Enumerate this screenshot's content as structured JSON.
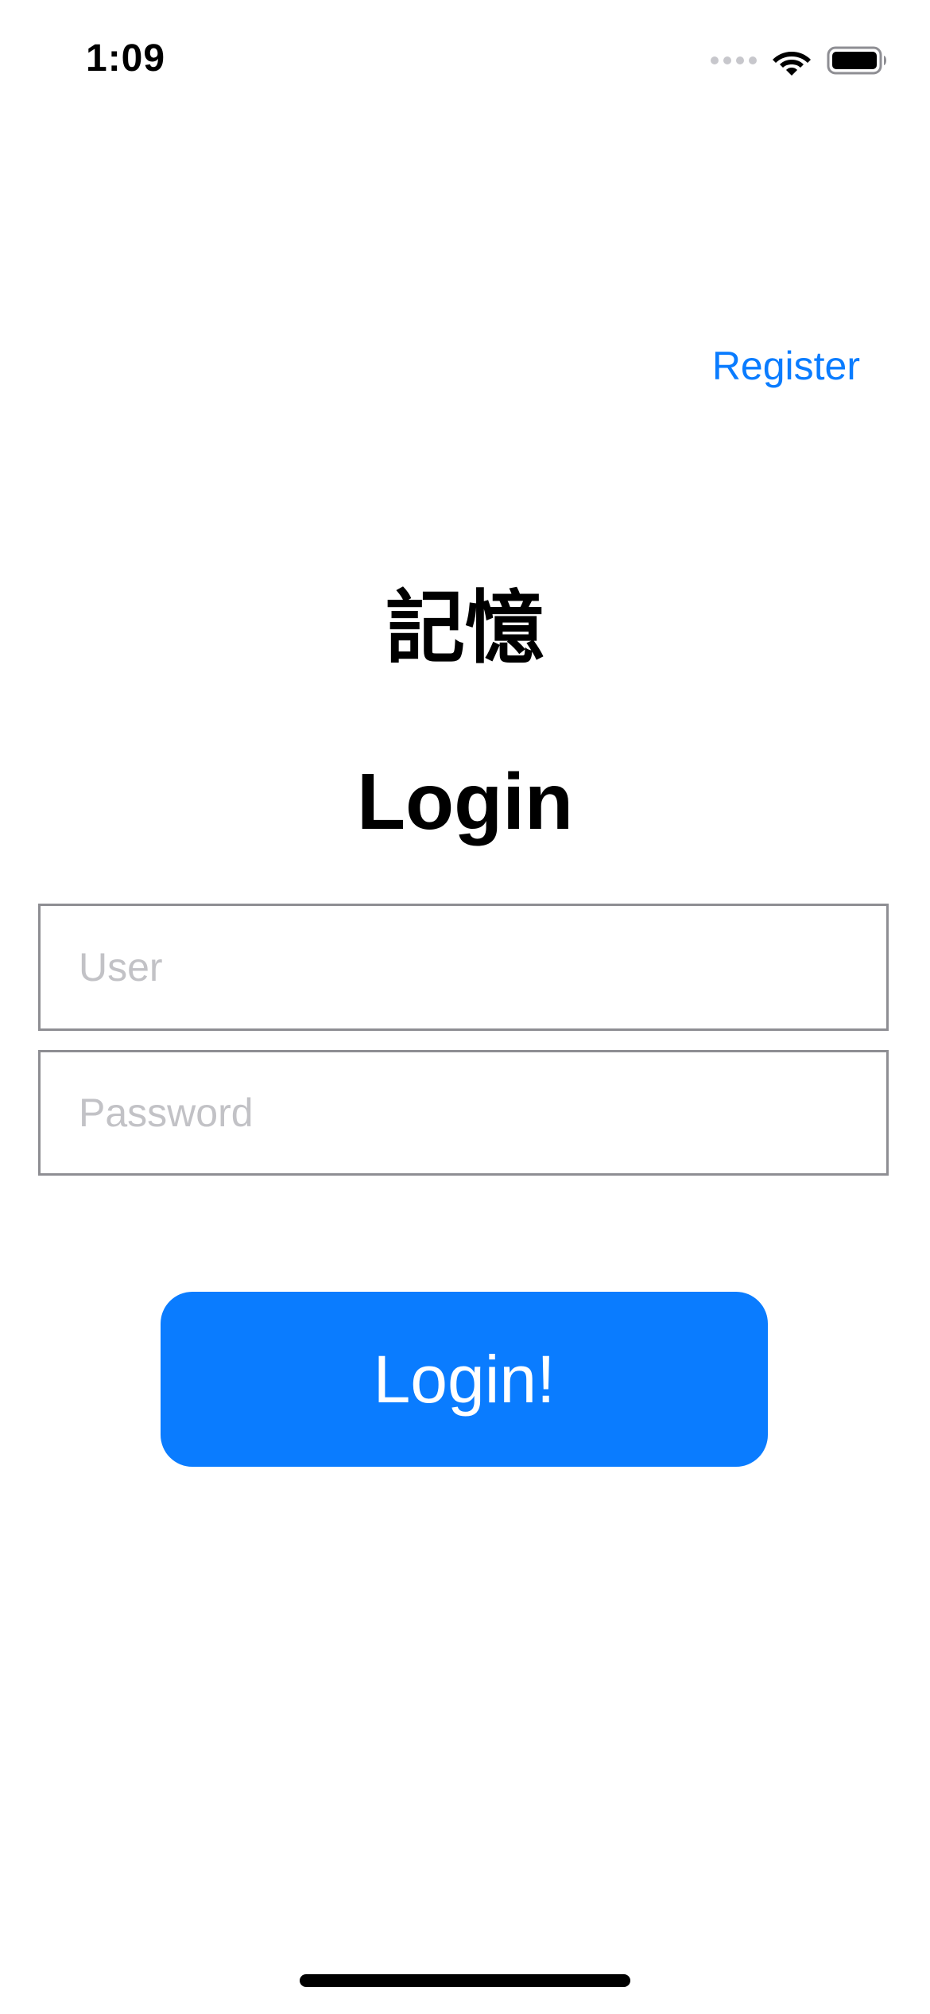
{
  "status_bar": {
    "time": "1:09",
    "icons": [
      "signal-icon",
      "wifi-icon",
      "battery-icon"
    ]
  },
  "nav": {
    "register_label": "Register"
  },
  "header": {
    "app_title": "記憶",
    "screen_title": "Login"
  },
  "form": {
    "user": {
      "placeholder": "User",
      "value": ""
    },
    "password": {
      "placeholder": "Password",
      "value": ""
    },
    "submit_label": "Login!"
  },
  "colors": {
    "accent": "#0a7cff",
    "background": "#ffffff",
    "field_border": "#8e8e93",
    "placeholder": "#c2c2c6"
  }
}
